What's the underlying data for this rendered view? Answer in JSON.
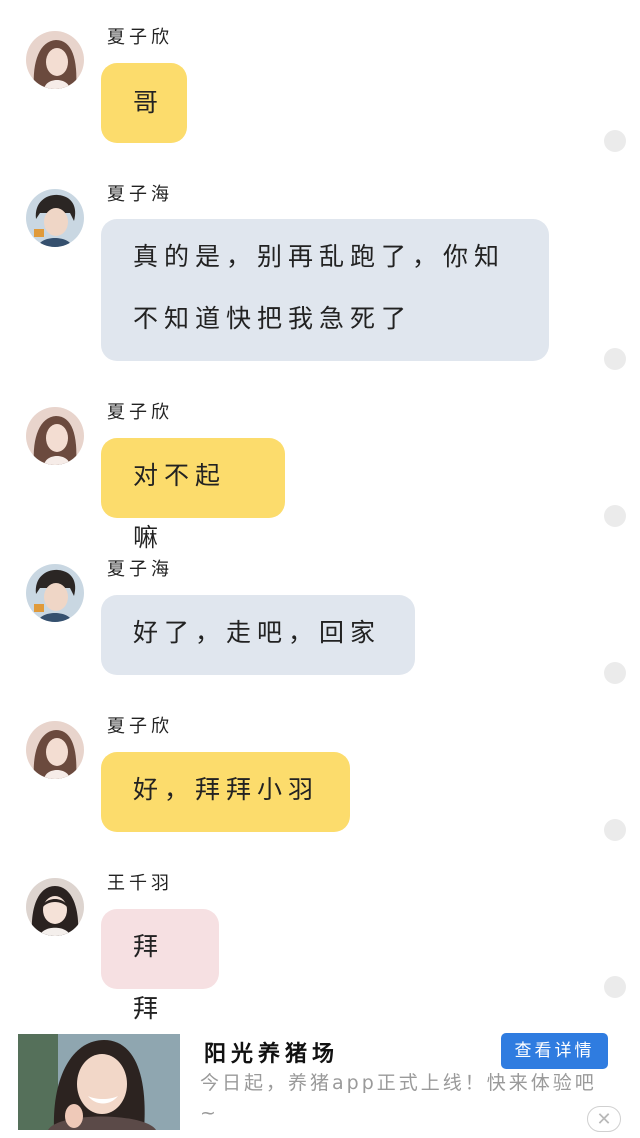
{
  "chat": {
    "messages": [
      {
        "sender": "夏子欣",
        "text": "哥"
      },
      {
        "sender": "夏子海",
        "text": "真的是，别再乱跑了，你知\n不知道快把我急死了"
      },
      {
        "sender": "夏子欣",
        "text": "对不起嘛"
      },
      {
        "sender": "夏子海",
        "text": "好了，走吧，回家"
      },
      {
        "sender": "夏子欣",
        "text": "好，拜拜小羽"
      },
      {
        "sender": "王千羽",
        "text": "拜拜"
      }
    ]
  },
  "colors": {
    "bubble_xia_zixin": "#fcdc6c",
    "bubble_xia_zihai": "#e0e6ee",
    "bubble_wang_qianyu": "#f6e0e2",
    "ad_button": "#2f7ce0"
  },
  "ad": {
    "title": "阳光养猪场",
    "description": "今日起，养猪app正式上线！快来体验吧~",
    "button_label": "查看详情",
    "close_icon": "close-icon"
  }
}
